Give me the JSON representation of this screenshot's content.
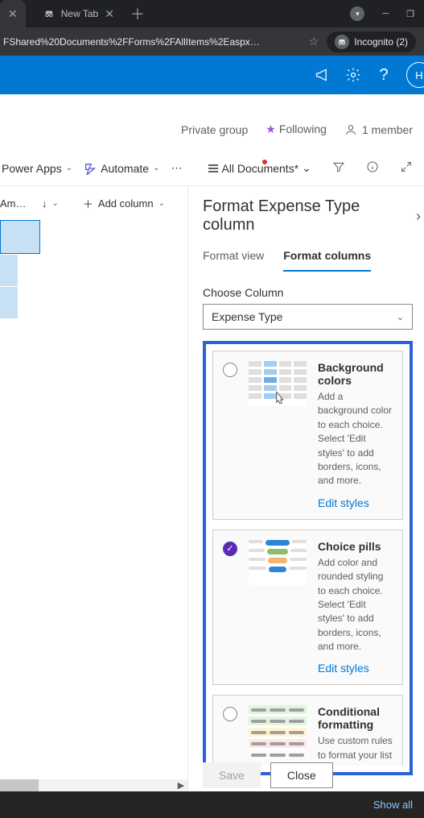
{
  "browser": {
    "tabs": [
      {
        "title": "",
        "active": true
      },
      {
        "title": "New Tab",
        "active": false
      }
    ],
    "url": "FShared%20Documents%2FForms%2FAllItems%2Easpx…",
    "incognito_label": "Incognito (2)"
  },
  "site_info": {
    "privacy": "Private group",
    "following": "Following",
    "members": "1 member"
  },
  "command_bar": {
    "power_apps": "Power Apps",
    "automate": "Automate",
    "view_selector": "All Documents*"
  },
  "list": {
    "col_am": "Am…",
    "add_column": "Add column"
  },
  "pane": {
    "title": "Format Expense Type column",
    "tabs": {
      "view": "Format view",
      "columns": "Format columns"
    },
    "choose_label": "Choose Column",
    "dropdown_value": "Expense Type",
    "options": {
      "bg": {
        "title": "Background colors",
        "desc": "Add a background color to each choice. Select 'Edit styles' to add borders, icons, and more.",
        "link": "Edit styles"
      },
      "pills": {
        "title": "Choice pills",
        "desc": "Add color and rounded styling to each choice. Select 'Edit styles' to add borders, icons, and more.",
        "link": "Edit styles"
      },
      "cond": {
        "title": "Conditional formatting",
        "desc": "Use custom rules to format your list"
      }
    },
    "actions": {
      "save": "Save",
      "close": "Close"
    }
  },
  "footer": {
    "show_all": "Show all"
  }
}
